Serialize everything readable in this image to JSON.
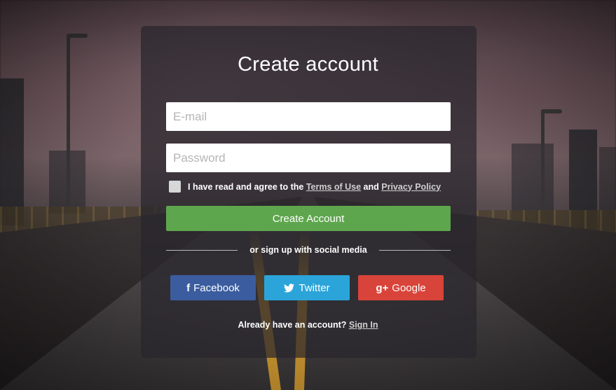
{
  "form": {
    "title": "Create account",
    "email_placeholder": "E-mail",
    "password_placeholder": "Password",
    "agree_prefix": "I have read and agree to the ",
    "terms_link": "Terms of Use",
    "agree_and": " and ",
    "privacy_link": "Privacy Policy",
    "create_button": "Create Account",
    "divider_text": "or sign up with social media"
  },
  "social": {
    "facebook": {
      "icon": "f",
      "label": "Facebook"
    },
    "twitter": {
      "label": "Twitter"
    },
    "google": {
      "icon": "g+",
      "label": "Google"
    }
  },
  "footer": {
    "prompt": "Already have an account? ",
    "signin_link": "Sign In"
  },
  "colors": {
    "create_button": "#5ea64d",
    "facebook": "#3b5d9f",
    "twitter": "#2ba4d9",
    "google": "#d9443a"
  }
}
